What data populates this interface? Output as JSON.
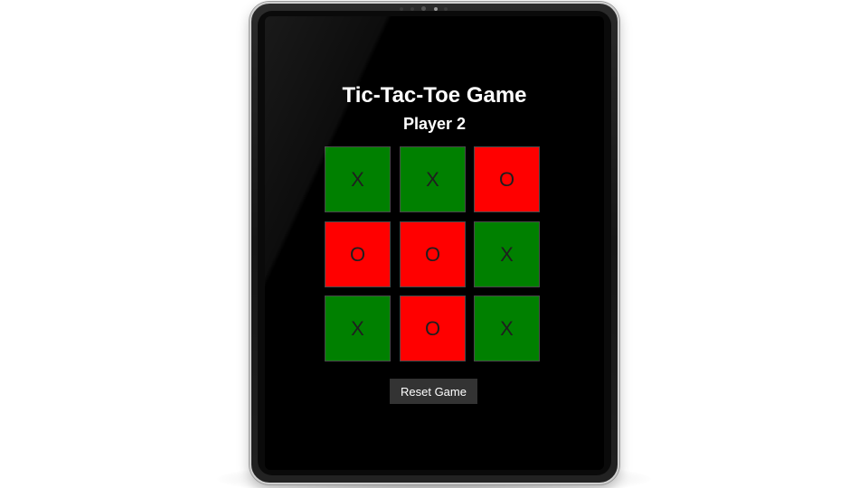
{
  "game": {
    "title": "Tic-Tac-Toe Game",
    "status": "Player 2",
    "reset_label": "Reset Game"
  },
  "board": {
    "cells": [
      {
        "mark": "X",
        "color": "#008000"
      },
      {
        "mark": "X",
        "color": "#008000"
      },
      {
        "mark": "O",
        "color": "#ff0000"
      },
      {
        "mark": "O",
        "color": "#ff0000"
      },
      {
        "mark": "O",
        "color": "#ff0000"
      },
      {
        "mark": "X",
        "color": "#008000"
      },
      {
        "mark": "X",
        "color": "#008000"
      },
      {
        "mark": "O",
        "color": "#ff0000"
      },
      {
        "mark": "X",
        "color": "#008000"
      }
    ]
  },
  "colors": {
    "x_cell": "#008000",
    "o_cell": "#ff0000",
    "screen_background": "#000000",
    "button_background": "#333333"
  }
}
